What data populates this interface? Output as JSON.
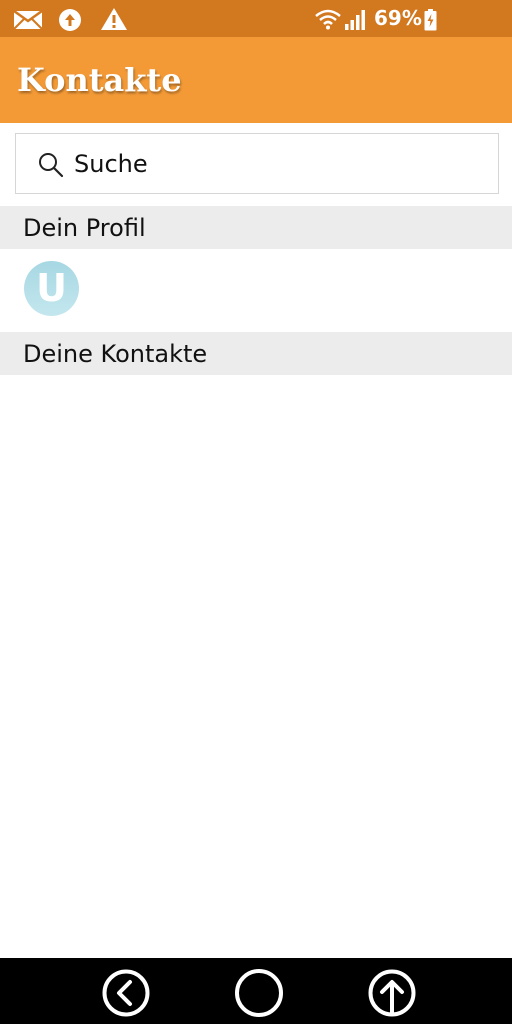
{
  "status_bar": {
    "battery_percent": "69%",
    "left_icons": [
      "mail-icon",
      "upload-notification-icon",
      "warning-icon"
    ],
    "right_icons": [
      "wifi-icon",
      "signal-icon",
      "battery-charging-icon"
    ]
  },
  "app_bar": {
    "title": "Kontakte",
    "color": "#f39a37"
  },
  "search": {
    "placeholder": "Suche"
  },
  "sections": {
    "profile_header": "Dein Profil",
    "contacts_header": "Deine Kontakte"
  },
  "profile": {
    "avatar_initial": "U"
  },
  "nav_bar": {
    "buttons": [
      "back-icon",
      "home-icon",
      "scroll-up-icon"
    ]
  }
}
